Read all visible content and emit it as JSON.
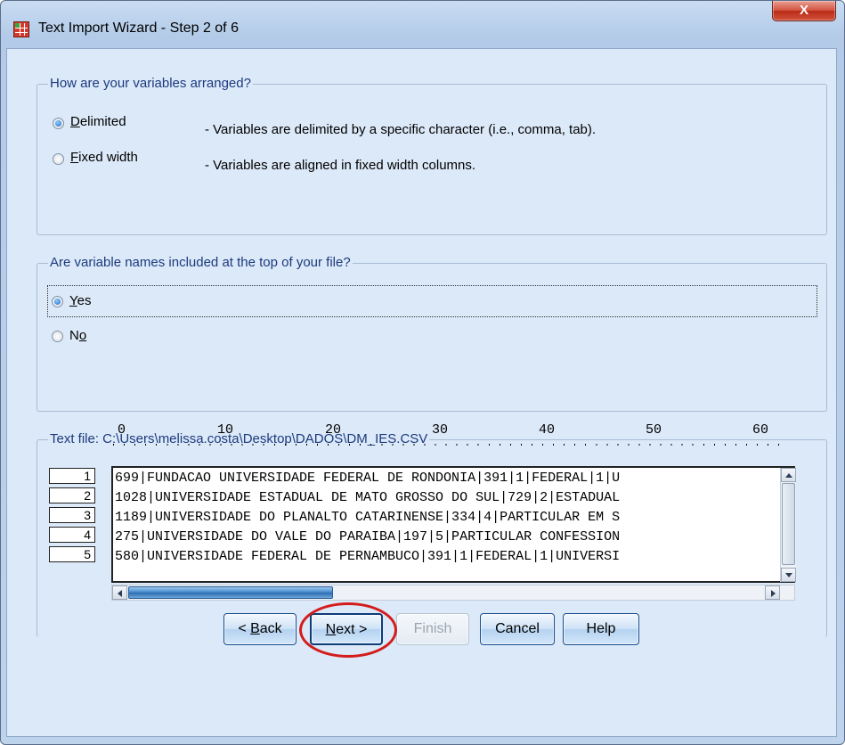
{
  "window": {
    "title": "Text Import Wizard - Step 2 of 6",
    "close_label": "X"
  },
  "arrangement": {
    "legend": "How are your variables arranged?",
    "options": [
      {
        "label": "Delimited",
        "mnemonic": "D",
        "rest": "elimited",
        "description": "- Variables are delimited by a specific character (i.e., comma, tab).",
        "selected": true
      },
      {
        "label": "Fixed width",
        "mnemonic": "F",
        "rest": "ixed width",
        "description": "- Variables are aligned in fixed width columns.",
        "selected": false
      }
    ]
  },
  "names": {
    "legend": "Are variable names included at the top of your file?",
    "options": [
      {
        "label": "Yes",
        "mnemonic": "Y",
        "rest": "es",
        "selected": true
      },
      {
        "label": "No",
        "pre": "N",
        "mnemonic": "o",
        "selected": false
      }
    ]
  },
  "preview": {
    "legend": "Text file:  C:\\Users\\melissa.costa\\Desktop\\DADOS\\DM_IES.CSV",
    "ruler_labels": [
      "0",
      "10",
      "20",
      "30",
      "40",
      "50",
      "60"
    ],
    "row_numbers": [
      "1",
      "2",
      "3",
      "4",
      "5"
    ],
    "lines": [
      "699|FUNDACAO UNIVERSIDADE FEDERAL DE RONDONIA|391|1|FEDERAL|1|U",
      "1028|UNIVERSIDADE ESTADUAL DE MATO GROSSO DO SUL|729|2|ESTADUAL",
      "1189|UNIVERSIDADE DO PLANALTO CATARINENSE|334|4|PARTICULAR EM S",
      "275|UNIVERSIDADE DO VALE DO PARAIBA|197|5|PARTICULAR CONFESSION",
      "580|UNIVERSIDADE FEDERAL DE PERNAMBUCO|391|1|FEDERAL|1|UNIVERSI"
    ]
  },
  "buttons": {
    "back": {
      "pre": "< ",
      "mnemonic": "B",
      "rest": "ack"
    },
    "next": {
      "mnemonic": "N",
      "rest": "ext >"
    },
    "finish": "Finish",
    "cancel": "Cancel",
    "help": "Help"
  },
  "colors": {
    "client_bg": "#dce9f8",
    "legend_text": "#1c3a7e",
    "highlight_circle": "#d41c1c",
    "close_button": "#c8402b"
  }
}
